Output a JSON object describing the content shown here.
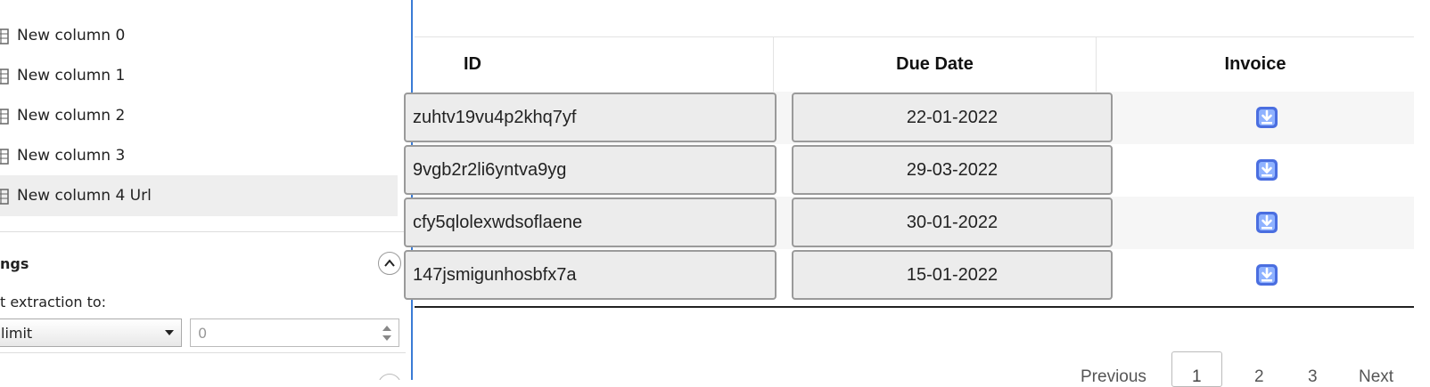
{
  "columns_panel": {
    "items": [
      {
        "label": "New column 0"
      },
      {
        "label": "New column 1"
      },
      {
        "label": "New column 2"
      },
      {
        "label": "New column 3"
      },
      {
        "label": "New column 4 Url",
        "selected": true
      }
    ],
    "settings_title": "ngs",
    "extraction_label": "t extraction to:",
    "limit_select_value": "limit",
    "limit_input_placeholder": "0"
  },
  "table": {
    "headers": {
      "id": "ID",
      "due_date": "Due Date",
      "invoice": "Invoice"
    },
    "rows": [
      {
        "id": "zuhtv19vu4p2khq7yf",
        "due_date": "22-01-2022",
        "invoice_icon": "download-icon"
      },
      {
        "id": "9vgb2r2li6yntva9yg",
        "due_date": "29-03-2022",
        "invoice_icon": "download-icon"
      },
      {
        "id": "cfy5qlolexwdsoflaene",
        "due_date": "30-01-2022",
        "invoice_icon": "download-icon"
      },
      {
        "id": "147jsmigunhosbfx7a",
        "due_date": "15-01-2022",
        "invoice_icon": "download-icon"
      }
    ]
  },
  "pagination": {
    "previous": "Previous",
    "pages": [
      "1",
      "2",
      "3"
    ],
    "current": "1",
    "next": "Next"
  },
  "colors": {
    "panel_border": "#3a7bd5",
    "download_icon": "#4a6ee0"
  }
}
